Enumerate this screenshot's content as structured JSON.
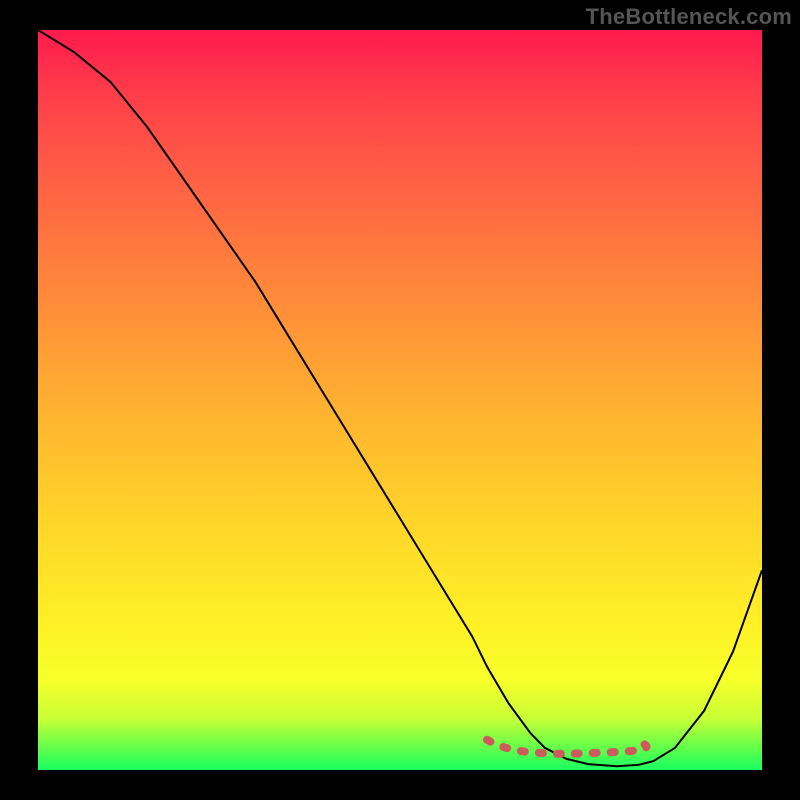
{
  "watermark": "TheBottleneck.com",
  "colors": {
    "page_background": "#000000",
    "gradient_top": "#ff1a4d",
    "gradient_bottom": "#18ff60",
    "curve": "#000000",
    "flat_marker": "#cc5c5c"
  },
  "chart_data": {
    "type": "line",
    "title": "",
    "xlabel": "",
    "ylabel": "",
    "x_range": [
      0,
      100
    ],
    "y_range": [
      0,
      100
    ],
    "series": [
      {
        "name": "bottleneck-curve",
        "x": [
          0,
          5,
          10,
          15,
          20,
          25,
          30,
          35,
          40,
          45,
          50,
          55,
          60,
          62,
          65,
          68,
          70,
          73,
          76,
          80,
          83,
          85,
          88,
          92,
          96,
          100
        ],
        "y": [
          100,
          97,
          93,
          87,
          80,
          73,
          66,
          58,
          50,
          42,
          34,
          26,
          18,
          14,
          9,
          5,
          3,
          1.5,
          0.8,
          0.5,
          0.7,
          1.2,
          3,
          8,
          16,
          27
        ]
      }
    ],
    "annotations": [
      {
        "name": "flat-minimum-marker",
        "x_start": 62,
        "x_end": 83,
        "y": 3
      }
    ],
    "background": "vertical-gradient red→orange→yellow→green"
  }
}
